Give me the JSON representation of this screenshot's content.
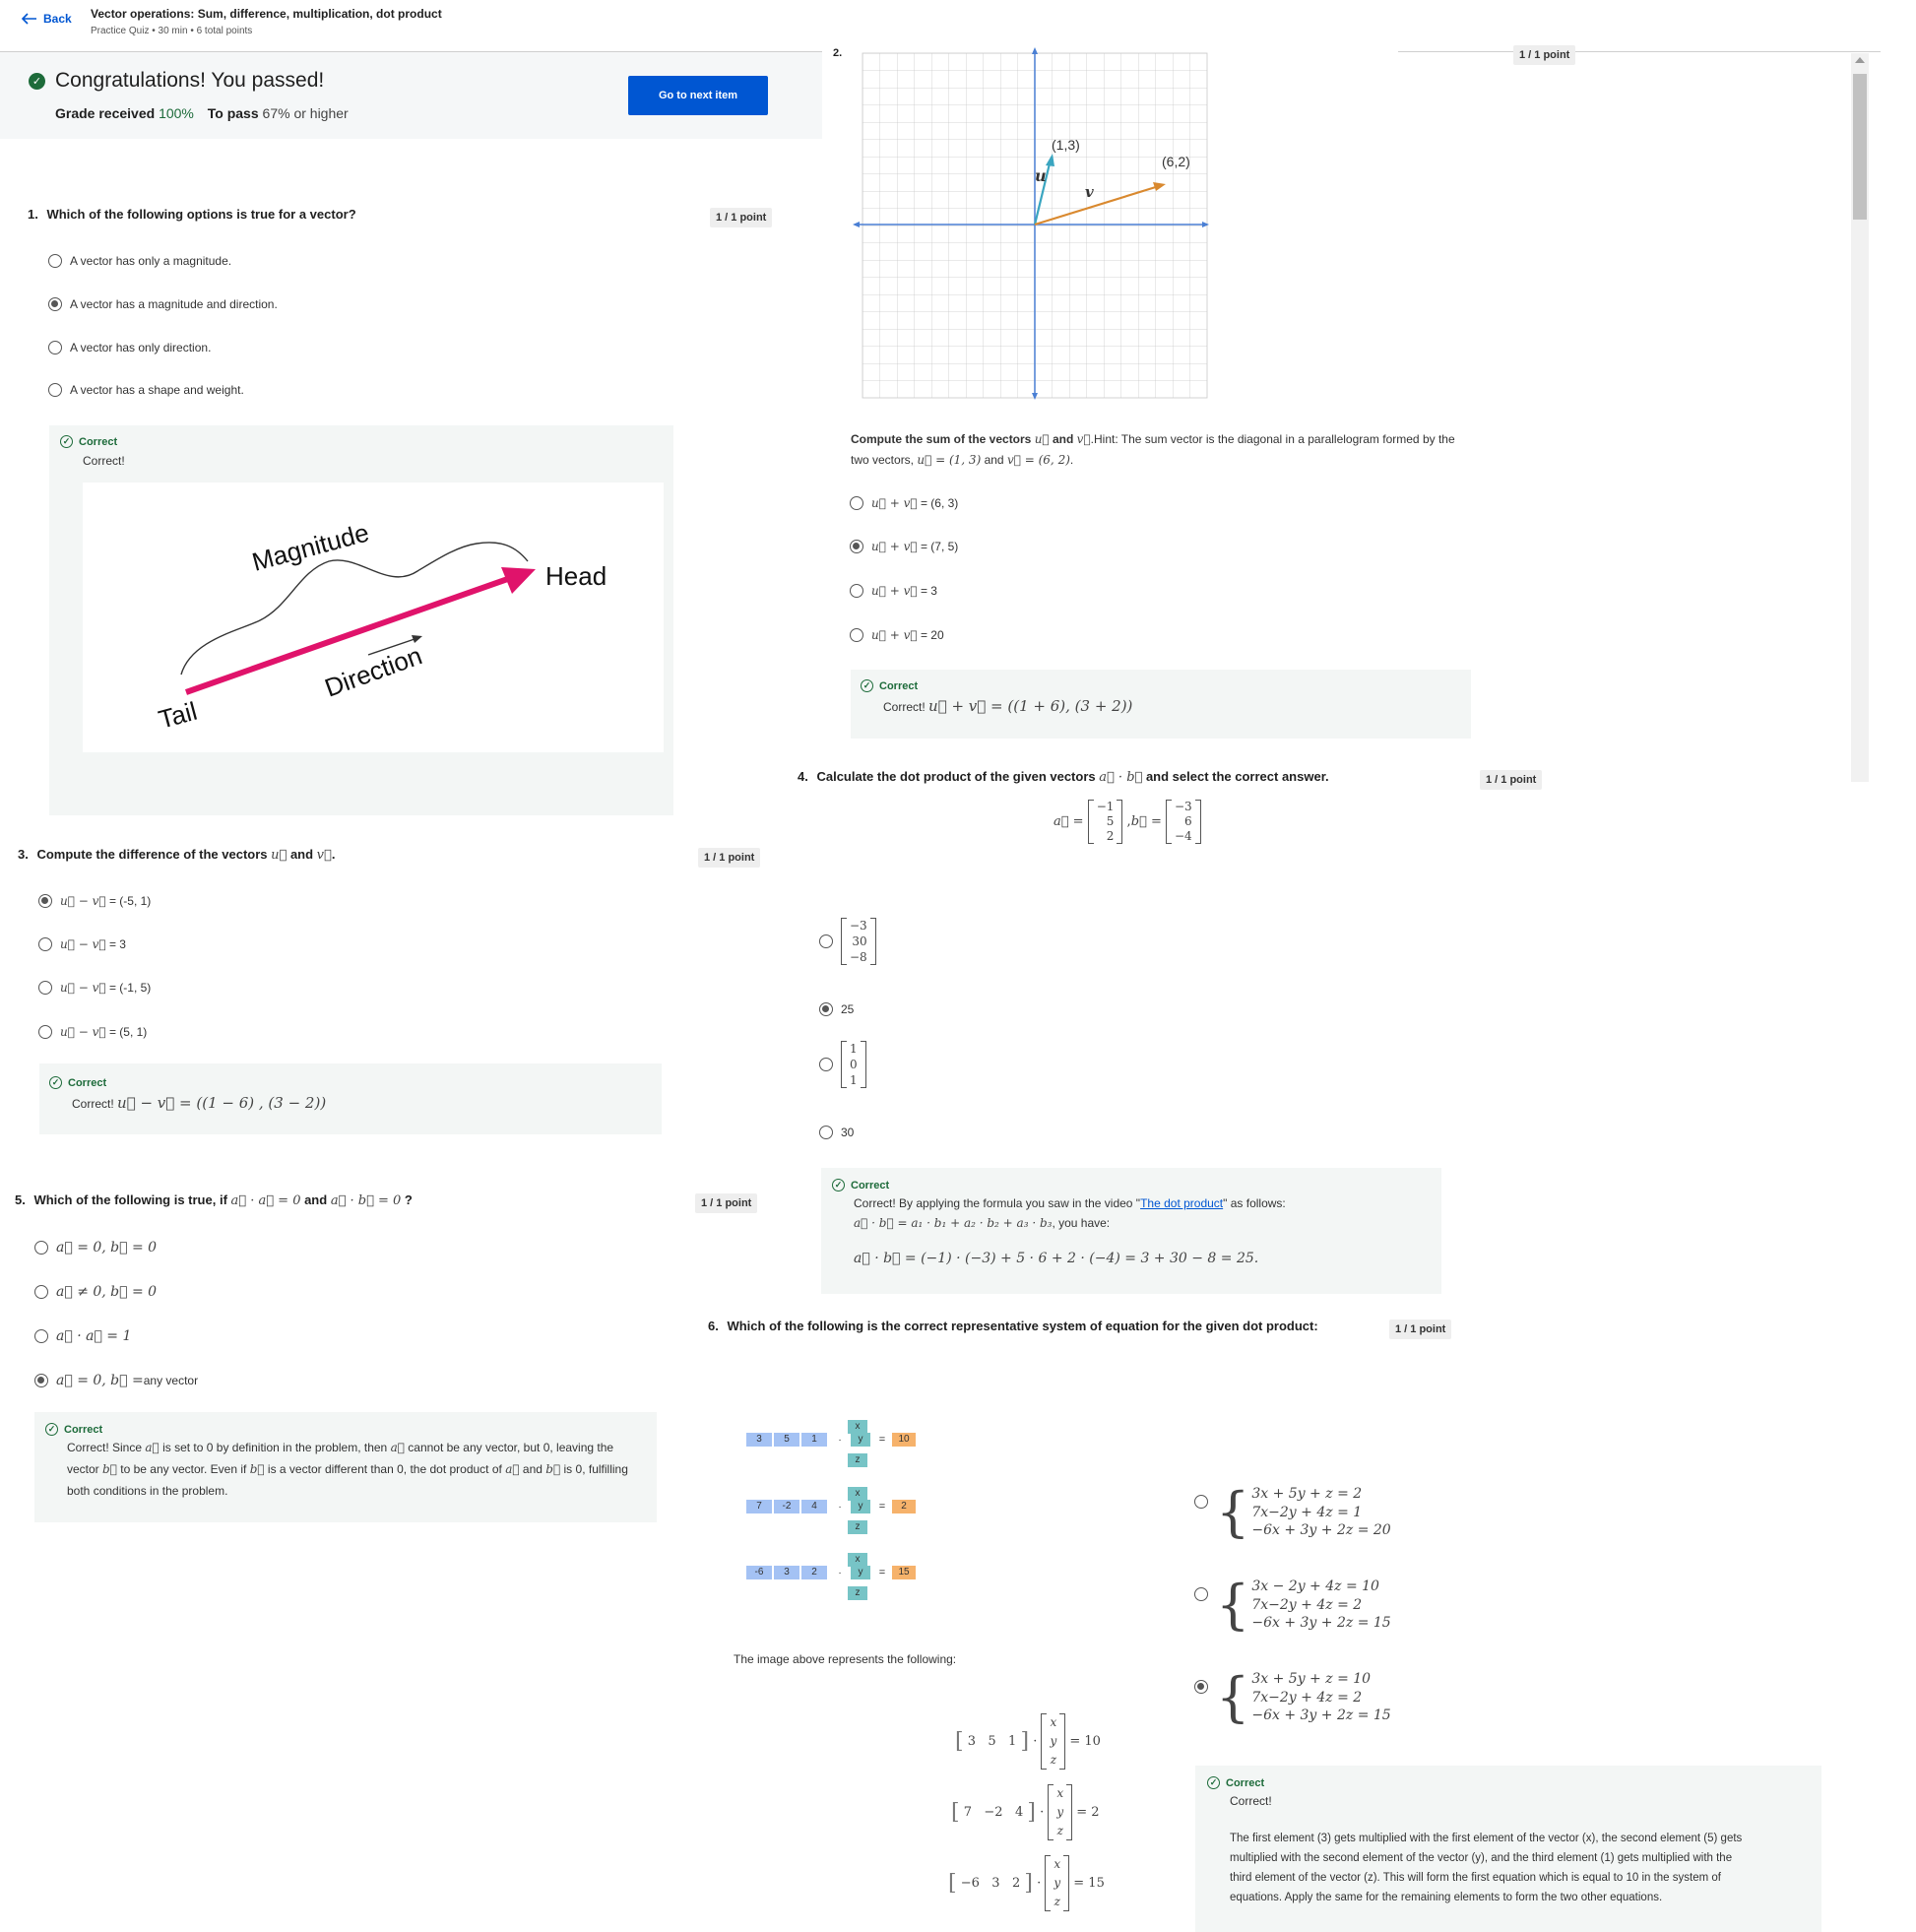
{
  "header": {
    "back_label": "Back",
    "title": "Vector operations: Sum, difference, multiplication, dot product",
    "meta": "Practice Quiz • 30 min • 6 total points"
  },
  "result": {
    "title": "Congratulations! You passed!",
    "grade_label": "Grade received",
    "grade_value": "100%",
    "pass_label": "To pass",
    "pass_value": "67% or higher",
    "next_button": "Go to next item"
  },
  "q1": {
    "number": "1.",
    "text": "Which of the following options is true for a vector?",
    "points": "1 / 1 point",
    "options": [
      "A vector has only a magnitude.",
      "A vector has a magnitude and direction.",
      "A vector has only direction.",
      "A vector has a shape and weight."
    ],
    "feedback_status": "Correct",
    "feedback_text": "Correct!",
    "diagram_labels": {
      "magnitude": "Magnitude",
      "head": "Head",
      "direction": "Direction",
      "tail": "Tail"
    }
  },
  "q2": {
    "number": "2.",
    "points": "1 / 1 point",
    "graph_labels": {
      "p1": "(1,3)",
      "p2": "(6,2)",
      "u": "u",
      "v": "v"
    },
    "text_bold": "Compute the sum of the vectors",
    "text_hint": "Hint: The sum vector is the diagonal in a parallelogram formed by the",
    "text_hint2": "two vectors,",
    "options": [
      "= (6, 3)",
      "= (7, 5)",
      "= 3",
      "= 20"
    ],
    "feedback_status": "Correct",
    "feedback_text": "Correct!"
  },
  "q3": {
    "number": "3.",
    "text": "Compute the difference of the vectors",
    "points": "1 / 1 point",
    "options": [
      "= (-5, 1)",
      "= 3",
      "= (-1, 5)",
      "= (5, 1)"
    ],
    "feedback_status": "Correct",
    "feedback_text": "Correct!"
  },
  "q4": {
    "number": "4.",
    "text": "Calculate the dot product of the given vectors",
    "text_tail": "and select the correct answer.",
    "points": "1 / 1 point",
    "options": [
      "25",
      "30"
    ],
    "feedback_status": "Correct",
    "feedback_text": "Correct! By applying the formula you saw in the video \"",
    "feedback_link": "The dot product",
    "feedback_text2": "\" as follows:",
    "feedback_text3": ", you have:"
  },
  "q5": {
    "number": "5.",
    "text": "Which of the following is true, if",
    "points": "1 / 1 point",
    "option4_tail": "any vector",
    "feedback_status": "Correct",
    "feedback_line1": "Correct! Since",
    "feedback_line1b": "is set to 0 by definition in the problem, then",
    "feedback_line1c": "cannot be any vector, but 0, leaving the",
    "feedback_line2a": "vector",
    "feedback_line2b": "to be any vector. Even if",
    "feedback_line2c": "is a vector different than 0, the dot product of",
    "feedback_line2d": "and",
    "feedback_line2e": "is 0, fulfilling",
    "feedback_line3": "both conditions in the problem."
  },
  "q6": {
    "number": "6.",
    "text": "Which of the following is the correct representative system of equation for the given dot product:",
    "points": "1 / 1 point",
    "table_rows": [
      {
        "coef": [
          "3",
          "5",
          "1"
        ],
        "result": "10"
      },
      {
        "coef": [
          "7",
          "-2",
          "4"
        ],
        "result": "2"
      },
      {
        "coef": [
          "-6",
          "3",
          "2"
        ],
        "result": "15"
      }
    ],
    "table_vars": [
      "x",
      "y",
      "z"
    ],
    "image_caption": "The image above represents the following:",
    "feedback_status": "Correct",
    "feedback_text": "Correct!",
    "feedback_explain1": "The first element (3) gets multiplied with the first element of the vector (x), the second element (5) gets",
    "feedback_explain2": "multiplied with the second element of the vector (y), and the third element (1) gets multiplied with the",
    "feedback_explain3": "third element of the vector (z). This will form the first equation which is equal to 10 in the system of",
    "feedback_explain4": "equations. Apply the same for the remaining elements to form the two other equations."
  },
  "colors": {
    "accent": "#0056d2",
    "success": "#1d6b3a",
    "pink": "#e0136b",
    "axis": "#4a7fd4",
    "u_vector": "#3aa5c0",
    "v_vector": "#d9892f"
  }
}
